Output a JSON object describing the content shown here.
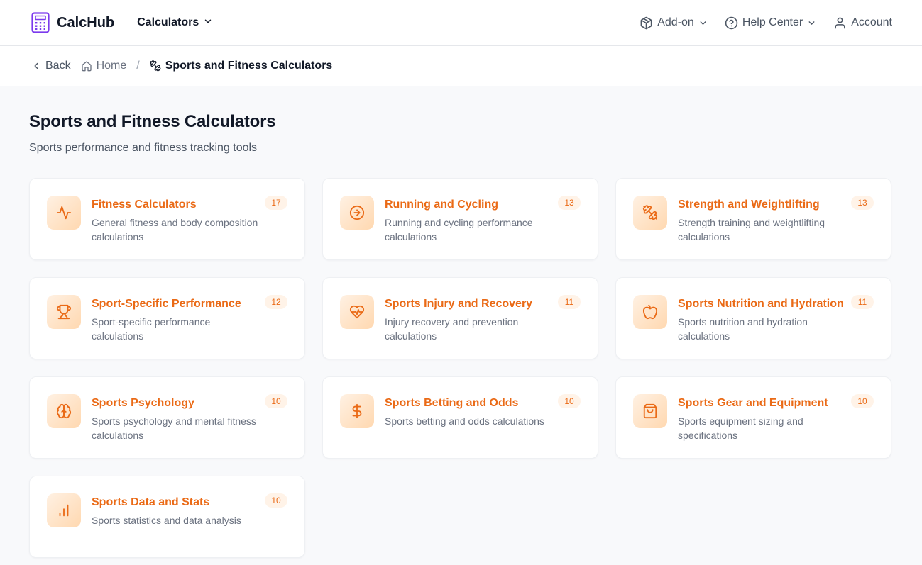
{
  "header": {
    "brand": "CalcHub",
    "calculators_label": "Calculators",
    "addon_label": "Add-on",
    "help_label": "Help Center",
    "account_label": "Account"
  },
  "breadcrumb": {
    "back": "Back",
    "home": "Home",
    "separator": "/",
    "current": "Sports and Fitness Calculators"
  },
  "page": {
    "title": "Sports and Fitness Calculators",
    "subtitle": "Sports performance and fitness tracking tools"
  },
  "colors": {
    "accent": "#ea6a16",
    "brand": "#7c3aed"
  },
  "categories": [
    {
      "title": "Fitness Calculators",
      "desc": "General fitness and body composition calculations",
      "count": "17",
      "icon": "activity-icon"
    },
    {
      "title": "Running and Cycling",
      "desc": "Running and cycling performance calculations",
      "count": "13",
      "icon": "arrow-circle-right-icon"
    },
    {
      "title": "Strength and Weightlifting",
      "desc": "Strength training and weightlifting calculations",
      "count": "13",
      "icon": "dumbbell-icon"
    },
    {
      "title": "Sport-Specific Performance",
      "desc": "Sport-specific performance calculations",
      "count": "12",
      "icon": "trophy-icon"
    },
    {
      "title": "Sports Injury and Recovery",
      "desc": "Injury recovery and prevention calculations",
      "count": "11",
      "icon": "heart-pulse-icon"
    },
    {
      "title": "Sports Nutrition and Hydration",
      "desc": "Sports nutrition and hydration calculations",
      "count": "11",
      "icon": "apple-icon"
    },
    {
      "title": "Sports Psychology",
      "desc": "Sports psychology and mental fitness calculations",
      "count": "10",
      "icon": "brain-icon"
    },
    {
      "title": "Sports Betting and Odds",
      "desc": "Sports betting and odds calculations",
      "count": "10",
      "icon": "dollar-icon"
    },
    {
      "title": "Sports Gear and Equipment",
      "desc": "Sports equipment sizing and specifications",
      "count": "10",
      "icon": "shopping-bag-icon"
    },
    {
      "title": "Sports Data and Stats",
      "desc": "Sports statistics and data analysis",
      "count": "10",
      "icon": "bar-chart-icon"
    }
  ]
}
